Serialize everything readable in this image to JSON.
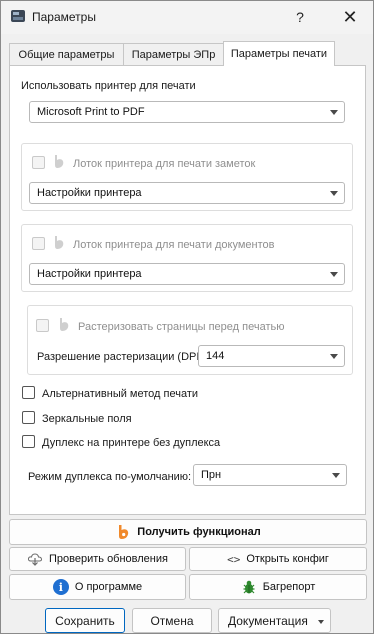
{
  "window": {
    "title": "Параметры",
    "help_glyph": "?",
    "close_glyph": "✕"
  },
  "tabs": [
    {
      "label": "Общие параметры",
      "active": false
    },
    {
      "label": "Параметры ЭПр",
      "active": false
    },
    {
      "label": "Параметры печати",
      "active": true
    }
  ],
  "print": {
    "use_printer_label": "Использовать принтер для печати",
    "printer_value": "Microsoft Print to PDF",
    "notes_tray": {
      "label": "Лоток принтера для печати заметок",
      "checked": false,
      "enabled": false,
      "combo_value": "Настройки принтера"
    },
    "docs_tray": {
      "label": "Лоток принтера для печати документов",
      "checked": false,
      "enabled": false,
      "combo_value": "Настройки принтера"
    },
    "rasterize": {
      "label": "Растеризовать страницы перед печатью",
      "checked": false,
      "enabled": false,
      "dpi_label": "Разрешение растеризации (DPI)",
      "dpi_value": "144"
    },
    "alt_method_label": "Альтернативный метод печати",
    "mirror_margins_label": "Зеркальные поля",
    "duplex_no_duplex_label": "Дуплекс на принтере без дуплекса",
    "duplex_default_label": "Режим дуплекса по-умолчанию:",
    "duplex_default_value": "Прн"
  },
  "actions": {
    "get_features": "Получить функционал",
    "check_updates": "Проверить обновления",
    "open_config": "Открыть конфиг",
    "open_config_glyph": "<>",
    "about": "О программе",
    "about_glyph": "i",
    "bug_report": "Багрепорт"
  },
  "dialog": {
    "save": "Сохранить",
    "cancel": "Отмена",
    "docs": "Документация"
  },
  "colors": {
    "accent": "#0067c0",
    "brand_orange": "#f0892b",
    "about_blue": "#1f6fd1",
    "bug_green": "#2f8a2f"
  }
}
